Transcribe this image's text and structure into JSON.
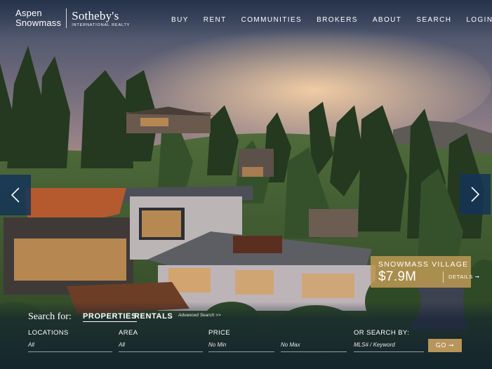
{
  "logo": {
    "line1": "Aspen",
    "line2": "Snowmass",
    "brand": "Sotheby's",
    "sub": "INTERNATIONAL REALTY"
  },
  "nav": {
    "items": [
      "BUY",
      "RENT",
      "COMMUNITIES",
      "BROKERS",
      "ABOUT",
      "SEARCH",
      "LOGIN"
    ],
    "search_icon": "search-icon"
  },
  "slider": {
    "prev_icon": "chevron-left-icon",
    "next_icon": "chevron-right-icon"
  },
  "listing": {
    "area": "SNOWMASS VILLAGE",
    "price": "$7.9M",
    "details": "DETAILS ➞"
  },
  "search": {
    "label": "Search for:",
    "tabs": [
      "PROPERTIES",
      "RENTALS"
    ],
    "active_tab": "PROPERTIES",
    "advanced": "Advanced Search >>",
    "locations_label": "LOCATIONS",
    "locations_value": "All",
    "area_label": "AREA",
    "area_value": "All",
    "price_label": "PRICE",
    "price_min": "No Min",
    "price_max": "No Max",
    "or_label": "OR SEARCH BY:",
    "keyword_placeholder": "MLS# / Keyword",
    "go": "GO ➞"
  },
  "colors": {
    "accent_gold": "#b8955a",
    "arrow_blue": "#143458"
  }
}
